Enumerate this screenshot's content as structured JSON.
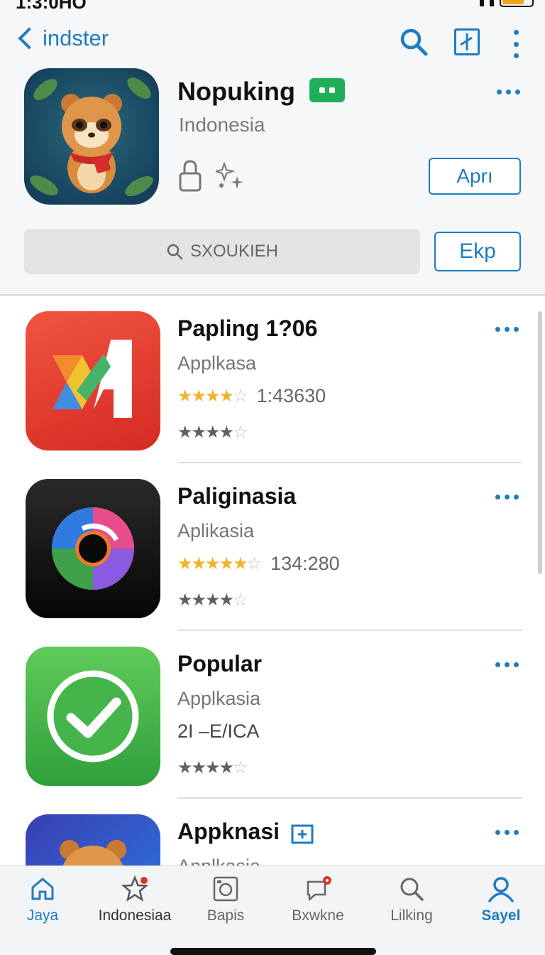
{
  "status": {
    "time": "1:3:0HO",
    "battery_color": "#f2a51a"
  },
  "nav": {
    "back_label": "indster",
    "icons": [
      "search-icon",
      "split-view-icon",
      "more-vertical-icon"
    ]
  },
  "hero": {
    "title": "Nopuking",
    "subtitle": "Indonesia",
    "badge_color": "#1faf5a",
    "primary_button": "Aprı",
    "search_placeholder": "SXOUKIEH",
    "secondary_button": "Ekp"
  },
  "apps": [
    {
      "name": "Papling 1?06",
      "category": "Applkasa",
      "rating_text": "1:43630",
      "stars_primary": 4,
      "stars_secondary": 3.5,
      "icon": "red-x-logo-icon"
    },
    {
      "name": "Paliginasia",
      "category": "Aplikasia",
      "rating_text": "134:280",
      "stars_primary": 4.5,
      "stars_secondary": 3.5,
      "icon": "swirl-logo-icon"
    },
    {
      "name": "Popular",
      "category": "Applkasia",
      "rating_text": "2I –E/ICA",
      "stars_primary": 0,
      "stars_secondary": 3.5,
      "icon": "checkmark-icon"
    },
    {
      "name": "Appknasi",
      "category": "Annlkasia",
      "icon": "raccoon-icon"
    }
  ],
  "tabs": [
    {
      "label": "Jaya",
      "icon": "home-icon",
      "active": true
    },
    {
      "label": "Indonesiaa",
      "icon": "star-icon",
      "active": false
    },
    {
      "label": "Bapis",
      "icon": "camera-icon",
      "active": false
    },
    {
      "label": "Bxwkne",
      "icon": "chat-bubble-icon",
      "active": false
    },
    {
      "label": "Lilking",
      "icon": "search-icon",
      "active": false
    },
    {
      "label": "Sayel",
      "icon": "person-icon",
      "active": true
    }
  ],
  "colors": {
    "accent": "#1f7bc1",
    "star": "#f0b429"
  }
}
